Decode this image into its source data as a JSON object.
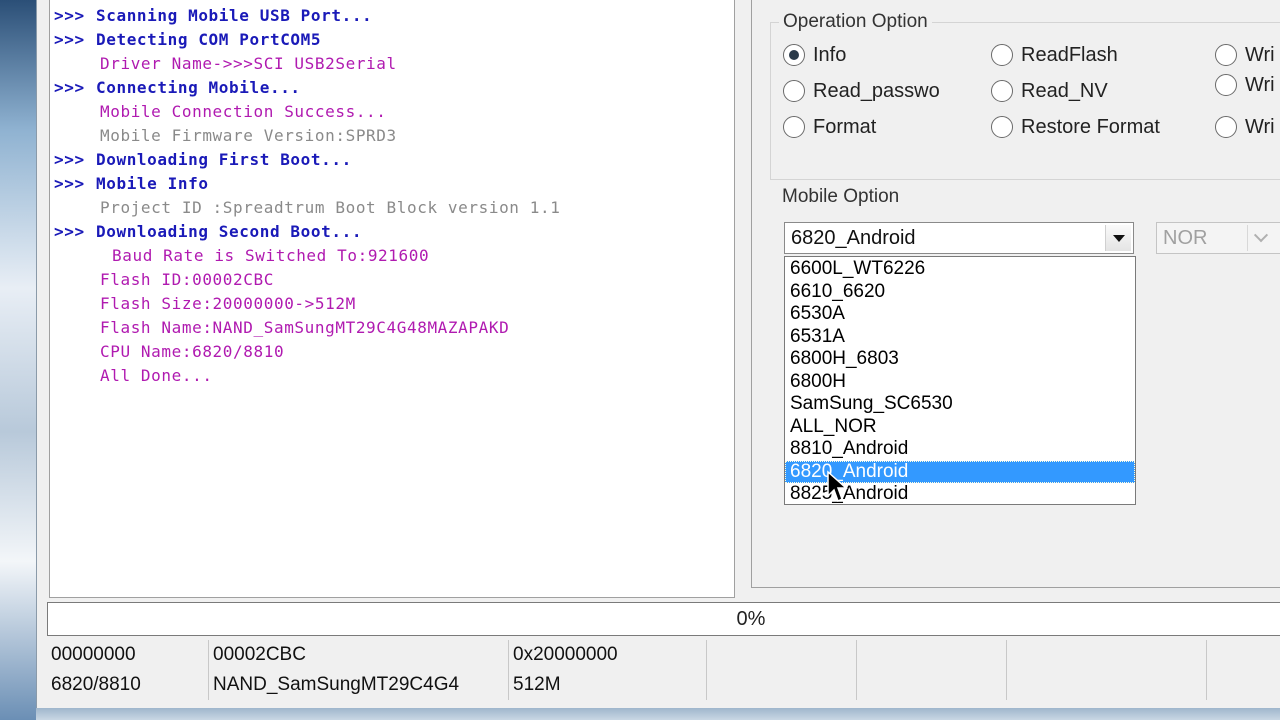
{
  "log": {
    "lines": [
      {
        "prompt": ">>>",
        "text": "Scanning Mobile USB Port..."
      },
      {
        "prompt": ">>>",
        "text": "Detecting COM PortCOM5"
      },
      {
        "text": "Driver Name->>>SCI USB2Serial"
      },
      {
        "prompt": ">>>",
        "text": "Connecting Mobile..."
      },
      {
        "text": "Mobile Connection Success..."
      },
      {
        "text": "Mobile Firmware Version:SPRD3"
      },
      {
        "prompt": ">>>",
        "text": "Downloading First Boot..."
      },
      {
        "prompt": ">>>",
        "text": "Mobile Info"
      },
      {
        "text": "Project ID :Spreadtrum Boot Block version 1.1"
      },
      {
        "prompt": ">>>",
        "text": "Downloading Second Boot..."
      },
      {
        "text": "Baud Rate is Switched To:921600"
      },
      {
        "text": "Flash ID:00002CBC"
      },
      {
        "text": "Flash Size:20000000->512M"
      },
      {
        "text": "Flash Name:NAND_SamSungMT29C4G48MAZAPAKD"
      },
      {
        "text": "CPU Name:6820/8810"
      },
      {
        "text": "All Done..."
      }
    ]
  },
  "operation_option": {
    "title": "Operation Option",
    "selected": "Info",
    "radios": [
      "Info",
      "ReadFlash",
      "Wri",
      "Read_passwo",
      "Read_NV",
      "Wri",
      "Format",
      "Restore Format",
      "Wri"
    ]
  },
  "mobile_option": {
    "title": "Mobile Option",
    "selected_value": "6820_Android",
    "secondary_value": "NOR",
    "dropdown_items": [
      "6600L_WT6226",
      "6610_6620",
      "6530A",
      "6531A",
      "6800H_6803",
      "6800H",
      "SamSung_SC6530",
      "ALL_NOR",
      "8810_Android",
      "6820_Android",
      "8825_Android"
    ],
    "highlighted_index": 9
  },
  "progress": {
    "label": "0%",
    "value": 0
  },
  "status": {
    "row1": [
      "00000000",
      "00002CBC",
      "0x20000000",
      "",
      "",
      "",
      ""
    ],
    "row2": [
      "6820/8810",
      "NAND_SamSungMT29C4G4",
      "512M",
      "",
      "",
      "",
      ""
    ]
  },
  "colors": {
    "log_prompt": "#1a1ab8",
    "log_purple": "#b01ab0",
    "log_gray": "#8a8a8a",
    "selection": "#3399ff"
  }
}
